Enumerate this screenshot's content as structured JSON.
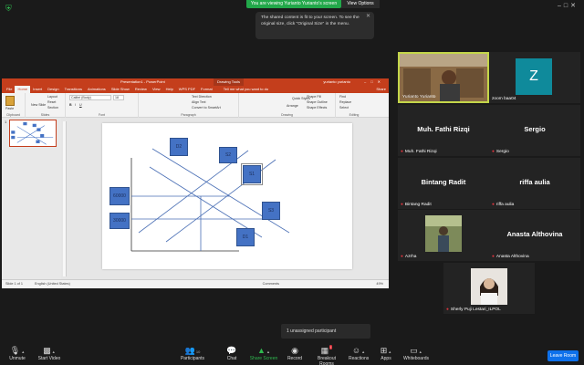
{
  "banner": {
    "share_text": "You are viewing Yurianto Yurianto's screen",
    "view_options": "View Options"
  },
  "notice": {
    "text": "The shared content is fit to your screen. To see the original size, click \"Original Size\" in the menu."
  },
  "ppt": {
    "doc_title": "Presentation1 - PowerPoint",
    "context_tab": "Drawing Tools",
    "user": "yurianto yurianto",
    "tabs": [
      "File",
      "Home",
      "Insert",
      "Design",
      "Transitions",
      "Animations",
      "Slide Show",
      "Review",
      "View",
      "Help",
      "WPS PDF",
      "Format"
    ],
    "tell_me": "Tell me what you want to do",
    "share": "Share",
    "ribbon": {
      "paste": "Paste",
      "clipboard": "Clipboard",
      "new_slide": "New Slide",
      "layout": "Layout",
      "reset": "Reset",
      "section": "Section",
      "slides": "Slides",
      "font_name": "Calibri (Body)",
      "font_size": "18",
      "font": "Font",
      "text_direction": "Text Direction",
      "align_text": "Align Text",
      "smartart": "Convert to SmartArt",
      "paragraph": "Paragraph",
      "arrange": "Arrange",
      "quick_styles": "Quick Styles",
      "shape_fill": "Shape Fill",
      "shape_outline": "Shape Outline",
      "shape_effects": "Shape Effects",
      "drawing": "Drawing",
      "find": "Find",
      "replace": "Replace",
      "select": "Select",
      "editing": "Editing"
    },
    "slide_number": "1",
    "slide_boxes": {
      "d2": "D2",
      "s2": "S2",
      "s1": "S1",
      "p60000": "60000",
      "p30000": "30000",
      "s3": "S3",
      "d1": "D1"
    },
    "status": {
      "slide_of": "Slide 1 of 1",
      "language": "English (United States)",
      "comments": "Comments",
      "zoom": "49%"
    }
  },
  "participants": [
    {
      "name": "Yurianto Yurianto",
      "display": ""
    },
    {
      "name": "zoom baa04",
      "display": "Z"
    },
    {
      "name": "Muh. Fathi Rizqi",
      "display": "Muh. Fathi Rizqi"
    },
    {
      "name": "Sergio",
      "display": "Sergio"
    },
    {
      "name": "Bintang Radit",
      "display": "Bintang Radit"
    },
    {
      "name": "riffa aulia",
      "display": "riffa aulia"
    },
    {
      "name": "Azrha",
      "display": ""
    },
    {
      "name": "Anasta Althovina",
      "display": "Anasta Althovina"
    },
    {
      "name": "Sherly Puji Lestari_ILPOL",
      "display": ""
    }
  ],
  "unassigned": "1 unassigned participant",
  "toolbar": {
    "unmute": "Unmute",
    "start_video": "Start Video",
    "participants": "Participants",
    "participants_count": "10",
    "chat": "Chat",
    "share_screen": "Share Screen",
    "record": "Record",
    "breakout_rooms": "Breakout Rooms",
    "reactions": "Reactions",
    "apps": "Apps",
    "whiteboards": "Whiteboards",
    "leave": "Leave Room"
  },
  "colors": {
    "share_green": "#22a84a",
    "ppt_red": "#c43e1c",
    "shape_blue": "#4472c4",
    "leave_blue": "#0e71eb",
    "active_speaker": "#c4d64a"
  }
}
